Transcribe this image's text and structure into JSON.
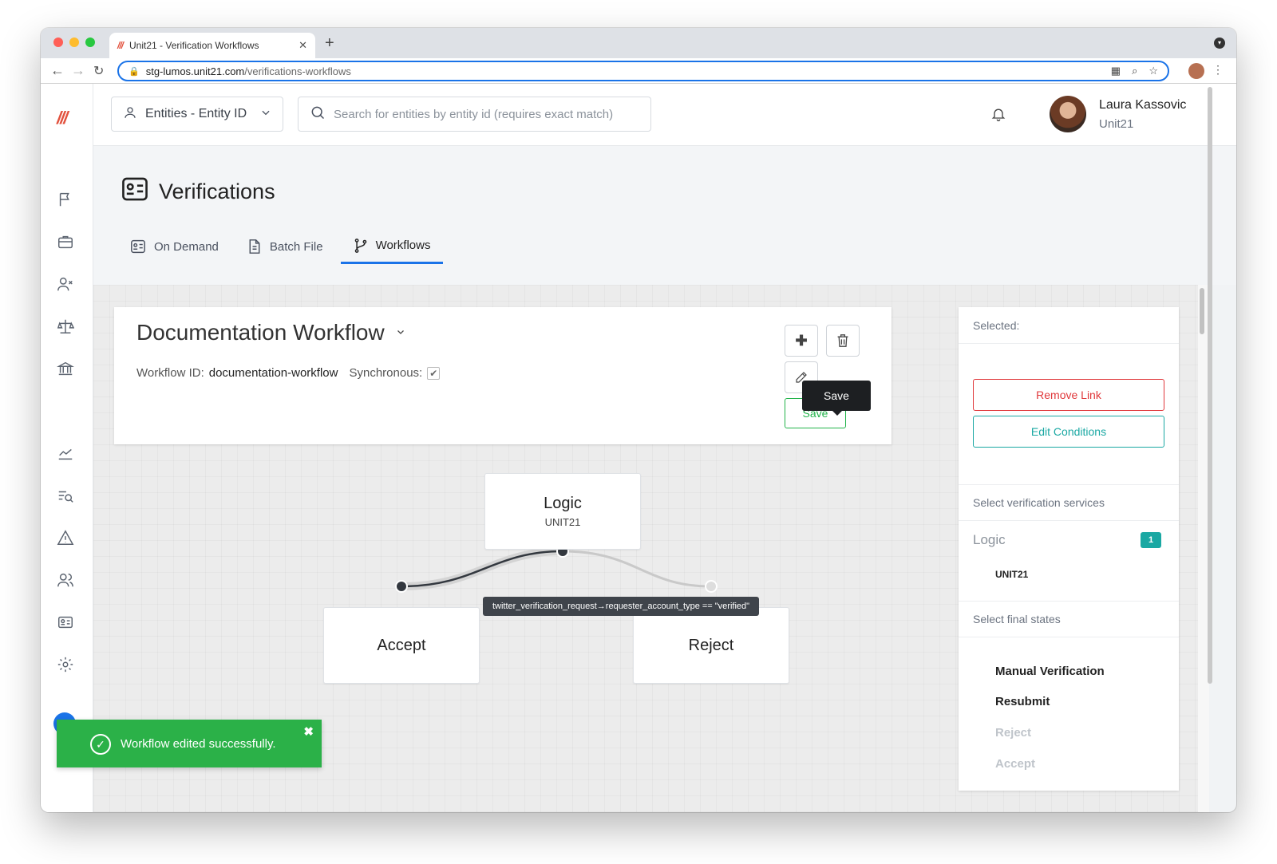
{
  "browser": {
    "tab_title": "Unit21 - Verification Workflows",
    "tab_favicon": "///",
    "url_domain": "stg-lumos.unit21.com",
    "url_path": "/verifications-workflows"
  },
  "header": {
    "entity_selector": "Entities - Entity ID",
    "search_placeholder": "Search for entities by entity id (requires exact match)",
    "user_name": "Laura Kassovic",
    "user_org": "Unit21"
  },
  "page": {
    "title": "Verifications",
    "tabs": [
      {
        "label": "On Demand",
        "icon": "id-card-icon"
      },
      {
        "label": "Batch File",
        "icon": "file-icon"
      },
      {
        "label": "Workflows",
        "icon": "git-branch-icon",
        "active": true
      }
    ]
  },
  "workflow": {
    "name": "Documentation Workflow",
    "id_label": "Workflow ID:",
    "id_value": "documentation-workflow",
    "sync_label": "Synchronous:",
    "synchronous": true,
    "save_label": "Save",
    "tooltip": "Save"
  },
  "graph": {
    "nodes": [
      {
        "title": "Logic",
        "subtitle": "UNIT21"
      },
      {
        "title": "Accept"
      },
      {
        "title": "Reject"
      }
    ],
    "link_condition": "twitter_verification_request→requester_account_type == \"verified\""
  },
  "panel": {
    "selected_label": "Selected:",
    "remove_link": "Remove Link",
    "edit_conditions": "Edit Conditions",
    "services_heading": "Select verification services",
    "service_group": "Logic",
    "service_count": "1",
    "service_item": "UNIT21",
    "final_heading": "Select final states",
    "final_states": [
      {
        "label": "Manual Verification",
        "enabled": true
      },
      {
        "label": "Resubmit",
        "enabled": true
      },
      {
        "label": "Reject",
        "enabled": false
      },
      {
        "label": "Accept",
        "enabled": false
      }
    ]
  },
  "toast": {
    "message": "Workflow edited successfully."
  },
  "colors": {
    "accent": "#1a73e8",
    "success": "#2bb148",
    "danger": "#e0383b",
    "teal": "#1aa8a3",
    "brand": "#e2523e"
  }
}
